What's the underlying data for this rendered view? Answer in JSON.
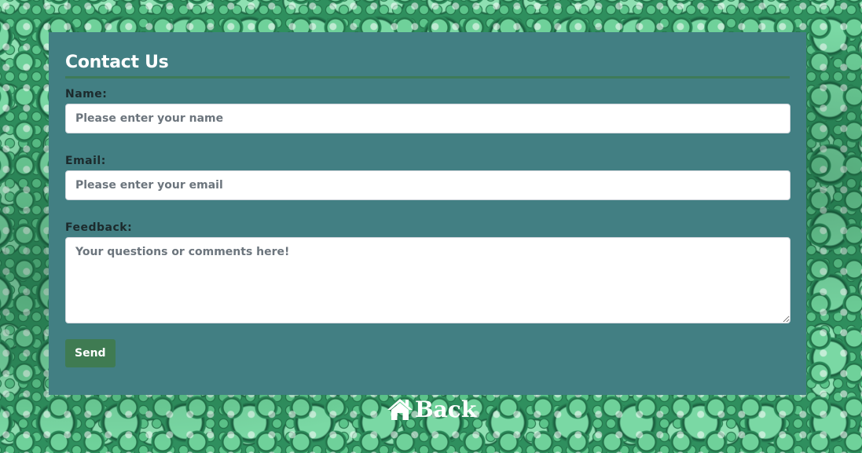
{
  "contact": {
    "title": "Contact Us",
    "name": {
      "label": "Name:",
      "placeholder": "Please enter your name",
      "value": ""
    },
    "email": {
      "label": "Email:",
      "placeholder": "Please enter your email",
      "value": ""
    },
    "feedback": {
      "label": "Feedback:",
      "placeholder": "Your questions or comments here!",
      "value": ""
    },
    "send_label": "Send"
  },
  "nav": {
    "back_label": "Back",
    "back_icon": "home-icon"
  },
  "colors": {
    "card_background": "#427f83",
    "accent_green": "#3f7b52",
    "title_rule": "#3e7a58"
  }
}
